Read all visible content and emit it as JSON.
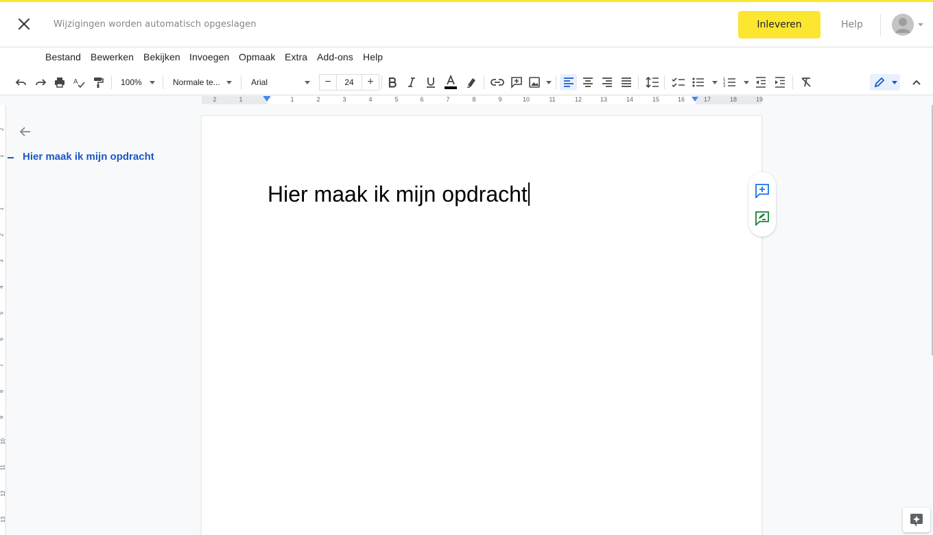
{
  "header": {
    "autosave_text": "Wijzigingen worden automatisch opgeslagen",
    "submit_label": "Inleveren",
    "help_label": "Help",
    "accent_color": "#fde62f"
  },
  "menu": {
    "items": [
      "Bestand",
      "Bewerken",
      "Bekijken",
      "Invoegen",
      "Opmaak",
      "Extra",
      "Add-ons",
      "Help"
    ]
  },
  "toolbar": {
    "zoom": "100%",
    "style": "Normale te...",
    "font": "Arial",
    "font_size": "24",
    "minus": "−",
    "plus": "+"
  },
  "ruler": {
    "labels": [
      "2",
      "1",
      "1",
      "2",
      "3",
      "4",
      "5",
      "6",
      "7",
      "8",
      "9",
      "10",
      "11",
      "12",
      "13",
      "14",
      "15",
      "16",
      "17",
      "18",
      "19"
    ],
    "vertical_labels": [
      "2",
      "1",
      "1",
      "2",
      "3",
      "4",
      "5",
      "6",
      "7",
      "8",
      "9",
      "10",
      "11",
      "12",
      "13"
    ]
  },
  "outline": {
    "heading": "Hier maak ik mijn opdracht"
  },
  "document": {
    "heading": "Hier maak ik mijn opdracht"
  }
}
